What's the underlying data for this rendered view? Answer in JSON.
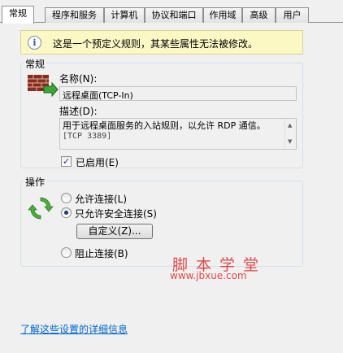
{
  "tabs": [
    {
      "label": "常规",
      "active": true
    },
    {
      "label": "程序和服务",
      "active": false
    },
    {
      "label": "计算机",
      "active": false
    },
    {
      "label": "协议和端口",
      "active": false
    },
    {
      "label": "作用域",
      "active": false
    },
    {
      "label": "高级",
      "active": false
    },
    {
      "label": "用户",
      "active": false
    }
  ],
  "info_bar": {
    "icon": "info-icon",
    "glyph": "i",
    "text": "这是一个预定义规则，其某些属性无法被修改。"
  },
  "general_group": {
    "title": "常规",
    "icon": "firewall-rule-icon",
    "name_label": "名称(N):",
    "name_value": "远程桌面(TCP-In)",
    "description_label": "描述(D):",
    "description_value_line1": "用于远程桌面服务的入站规则，以允许 RDP 通信。",
    "description_value_line2": "[TCP 3389]",
    "enabled_label": "已启用(E)",
    "enabled_checked": true
  },
  "action_group": {
    "title": "操作",
    "icon": "connection-arrows-icon",
    "options": [
      {
        "label": "允许连接(L)",
        "checked": false
      },
      {
        "label": "只允许安全连接(S)",
        "checked": true
      },
      {
        "label": "阻止连接(B)",
        "checked": false
      }
    ],
    "customize_button": "自定义(Z)..."
  },
  "watermark": {
    "line1": "脚本学堂",
    "line2": "www.jbxue.com"
  },
  "footer_link": "了解这些设置的详细信息",
  "colors": {
    "info_background": "#fbf8c4",
    "link": "#0066cc",
    "watermark": "#e04848"
  }
}
